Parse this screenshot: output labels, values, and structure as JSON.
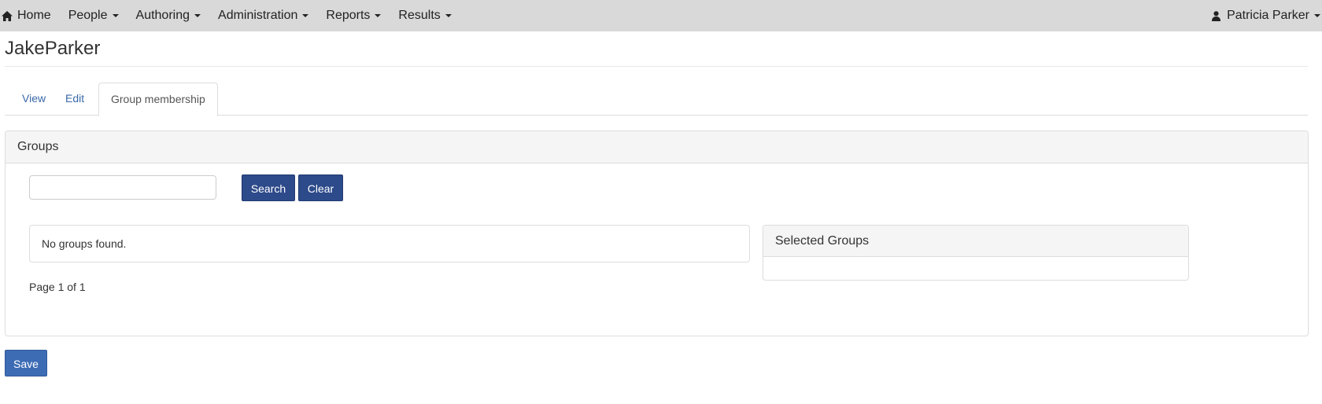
{
  "nav": {
    "home": "Home",
    "items": [
      "People",
      "Authoring",
      "Administration",
      "Reports",
      "Results"
    ],
    "user": "Patricia Parker"
  },
  "page": {
    "title": "JakeParker"
  },
  "tabs": [
    {
      "label": "View",
      "active": false
    },
    {
      "label": "Edit",
      "active": false
    },
    {
      "label": "Group membership",
      "active": true
    }
  ],
  "groups_panel": {
    "heading": "Groups",
    "search": {
      "value": "",
      "placeholder": ""
    },
    "search_button": "Search",
    "clear_button": "Clear",
    "results_message": "No groups found.",
    "pager": "Page 1 of 1",
    "selected_heading": "Selected Groups"
  },
  "save_button": "Save",
  "colors": {
    "navbar_bg": "#d9d9d9",
    "link": "#3a6aa8",
    "primary_dark": "#2d4a8a",
    "primary": "#3d6cb5"
  }
}
